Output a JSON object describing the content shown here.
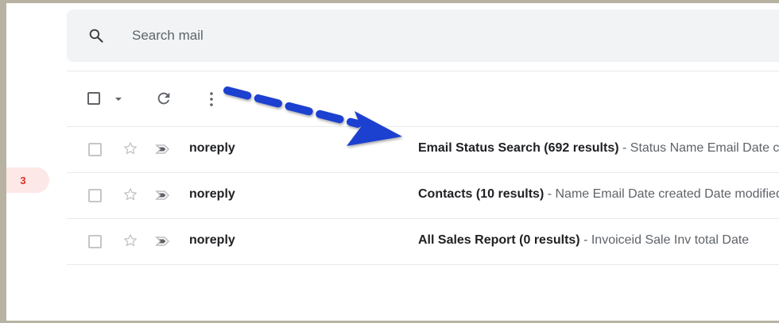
{
  "search": {
    "placeholder": "Search mail"
  },
  "sidebar": {
    "unread_count": "3"
  },
  "emails": [
    {
      "sender": "noreply",
      "subject": "Email Status Search (692 results)",
      "snippet": " - Status Name Email Date created Date sent"
    },
    {
      "sender": "noreply",
      "subject": "Contacts (10 results)",
      "snippet": " - Name Email Date created Date modified"
    },
    {
      "sender": "noreply",
      "subject": "All Sales Report (0 results)",
      "snippet": " - Invoiceid Sale Inv total Date"
    }
  ],
  "icons": {
    "search": "search-icon",
    "refresh": "refresh-icon",
    "more": "more-vert-icon",
    "star": "star-outline-icon",
    "important": "important-marker-icon"
  },
  "colors": {
    "annotation_arrow": "#1d3fcf",
    "badge_bg": "#fce8e6",
    "badge_text": "#d93025",
    "search_bg": "#f1f3f4"
  }
}
